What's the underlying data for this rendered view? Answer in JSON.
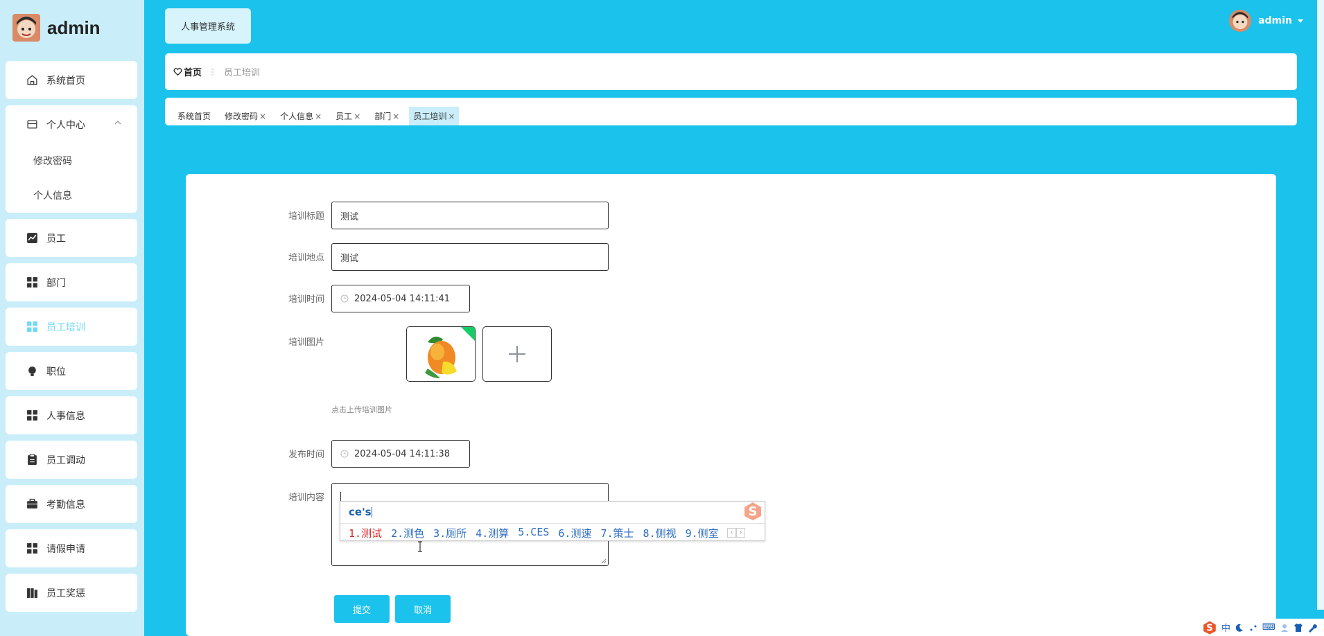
{
  "brand": {
    "name": "admin"
  },
  "header": {
    "app_title": "人事管理系统",
    "user": "admin"
  },
  "sidebar": {
    "items": [
      {
        "label": "系统首页",
        "icon": "home-icon"
      },
      {
        "label": "个人中心",
        "icon": "profile-icon",
        "children": [
          "修改密码",
          "个人信息"
        ]
      },
      {
        "label": "员工",
        "icon": "chart-icon"
      },
      {
        "label": "部门",
        "icon": "grid-icon"
      },
      {
        "label": "员工培训",
        "icon": "grid-icon",
        "active": true
      },
      {
        "label": "职位",
        "icon": "bulb-icon"
      },
      {
        "label": "人事信息",
        "icon": "grid-icon"
      },
      {
        "label": "员工调动",
        "icon": "clipboard-icon"
      },
      {
        "label": "考勤信息",
        "icon": "briefcase-icon"
      },
      {
        "label": "请假申请",
        "icon": "grid-icon"
      },
      {
        "label": "员工奖惩",
        "icon": "book-icon"
      }
    ]
  },
  "breadcrumb": {
    "home": "首页",
    "current": "员工培训"
  },
  "tabs": [
    {
      "label": "系统首页",
      "closable": false
    },
    {
      "label": "修改密码",
      "closable": true
    },
    {
      "label": "个人信息",
      "closable": true
    },
    {
      "label": "员工",
      "closable": true
    },
    {
      "label": "部门",
      "closable": true
    },
    {
      "label": "员工培训",
      "closable": true,
      "active": true
    }
  ],
  "close_glyph": "×",
  "form": {
    "title": {
      "label": "培训标题",
      "value": "测试"
    },
    "location": {
      "label": "培训地点",
      "value": "测试"
    },
    "time": {
      "label": "培训时间",
      "value": "2024-05-04 14:11:41"
    },
    "image": {
      "label": "培训图片",
      "hint": "点击上传培训图片"
    },
    "publish_time": {
      "label": "发布时间",
      "value": "2024-05-04 14:11:38"
    },
    "content": {
      "label": "培训内容",
      "value": ""
    },
    "submit": "提交",
    "cancel": "取消"
  },
  "ime": {
    "composition": "ce's",
    "candidates": [
      "1.测试",
      "2.测色",
      "3.厕所",
      "4.测算",
      "5.CES",
      "6.测速",
      "7.策士",
      "8.侧视",
      "9.侧室"
    ],
    "prev": "‹",
    "next": "›"
  },
  "tray": {
    "items": [
      "中",
      "⌨"
    ]
  },
  "colors": {
    "accent": "#1bc2ec",
    "sidebar_bg": "#c9eefa",
    "active_menu": "#6fd8f2"
  }
}
